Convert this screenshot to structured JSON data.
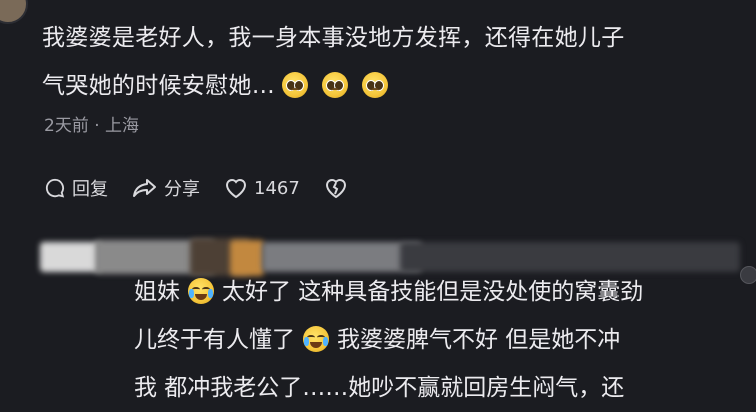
{
  "comment": {
    "line1": "我婆婆是老好人，我一身本事没地方发挥，还得在她儿子",
    "line2": "气哭她的时候安慰她…",
    "emojis": [
      "pleading-face-icon",
      "pleading-face-icon",
      "pleading-face-icon"
    ],
    "time": "2天前",
    "location": "上海",
    "actions": {
      "reply_label": "回复",
      "share_label": "分享",
      "like_count": "1467"
    }
  },
  "reply": {
    "segments": [
      {
        "text": "姐妹"
      },
      {
        "text": "太好了 这种具备技能但是没处使的窝囊劲"
      },
      {
        "text": "儿终于有人懂了"
      },
      {
        "text": "我婆婆脾气不好 但是她不冲"
      },
      {
        "text": "我 都冲我老公了……她吵不赢就回房生闷气，还"
      }
    ],
    "emoji_name": "laughing-crying-face-icon"
  }
}
